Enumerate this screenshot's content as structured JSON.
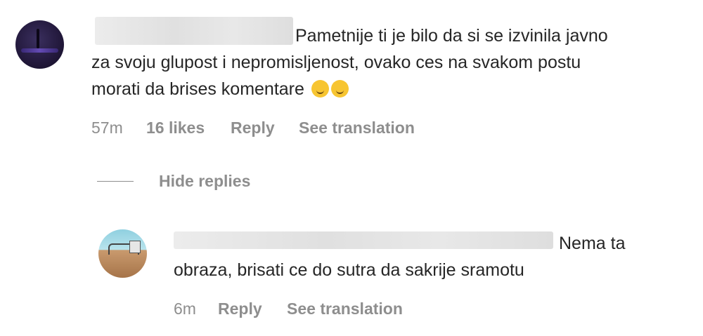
{
  "comment": {
    "lines": [
      "Pametnije ti je bilo da si se izvinila javno",
      "za svoju glupost i nepromisljenost, ovako ces na svakom postu",
      "morati da brises komentare"
    ],
    "emojis": [
      "rolling-on-floor-laughing-emoji",
      "smiling-face-with-tear-emoji"
    ],
    "time": "57m",
    "likes": "16 likes",
    "reply_label": "Reply",
    "translate_label": "See translation"
  },
  "replies_toggle": {
    "label": "Hide replies"
  },
  "reply": {
    "lines": [
      "Nema ta",
      "obraza, brisati ce do sutra da sakrije sramotu"
    ],
    "time": "6m",
    "reply_label": "Reply",
    "translate_label": "See translation"
  }
}
